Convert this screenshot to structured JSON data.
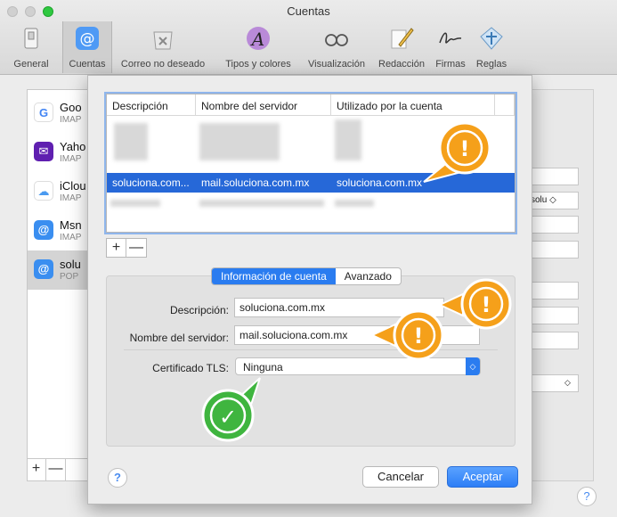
{
  "window": {
    "title": "Cuentas"
  },
  "toolbar": {
    "items": [
      {
        "label": "General",
        "icon": "switch-icon"
      },
      {
        "label": "Cuentas",
        "icon": "at-sign-icon"
      },
      {
        "label": "Correo no deseado",
        "icon": "junk-trash-icon"
      },
      {
        "label": "Tipos y colores",
        "icon": "fonts-icon"
      },
      {
        "label": "Visualización",
        "icon": "glasses-icon"
      },
      {
        "label": "Redacción",
        "icon": "pencil-icon"
      },
      {
        "label": "Firmas",
        "icon": "signature-icon"
      },
      {
        "label": "Reglas",
        "icon": "rules-icon"
      }
    ]
  },
  "accounts": [
    {
      "name": "Goo",
      "type": "IMAP",
      "icon": "google-icon"
    },
    {
      "name": "Yaho",
      "type": "IMAP",
      "icon": "yahoo-icon"
    },
    {
      "name": "iClou",
      "type": "IMAP",
      "icon": "icloud-icon"
    },
    {
      "name": "Msn",
      "type": "IMAP",
      "icon": "at-sign-icon"
    },
    {
      "name": "solu",
      "type": "POP",
      "icon": "at-sign-icon"
    }
  ],
  "account_list_buttons": {
    "add": "+",
    "remove": "—"
  },
  "bg_select_value": "solu",
  "smtp_table": {
    "headers": [
      "Descripción",
      "Nombre del servidor",
      "Utilizado por la cuenta"
    ],
    "selected_row": [
      "soluciona.com...",
      "mail.soluciona.com.mx",
      "soluciona.com.mx"
    ]
  },
  "table_buttons": {
    "add": "+",
    "remove": "—"
  },
  "tabs": [
    "Información de cuenta",
    "Avanzado"
  ],
  "form": {
    "description_label": "Descripción:",
    "description_value": "soluciona.com.mx",
    "server_label": "Nombre del servidor:",
    "server_value": "mail.soluciona.com.mx",
    "tls_label": "Certificado TLS:",
    "tls_value": "Ninguna"
  },
  "help": "?",
  "buttons": {
    "cancel": "Cancelar",
    "ok": "Aceptar"
  },
  "callout_glyphs": {
    "warning": "!",
    "check": "✓"
  },
  "colors": {
    "accent": "#2a7cf0",
    "selection": "#2668d8",
    "warning": "#f5a01a",
    "success": "#3fb53f"
  }
}
